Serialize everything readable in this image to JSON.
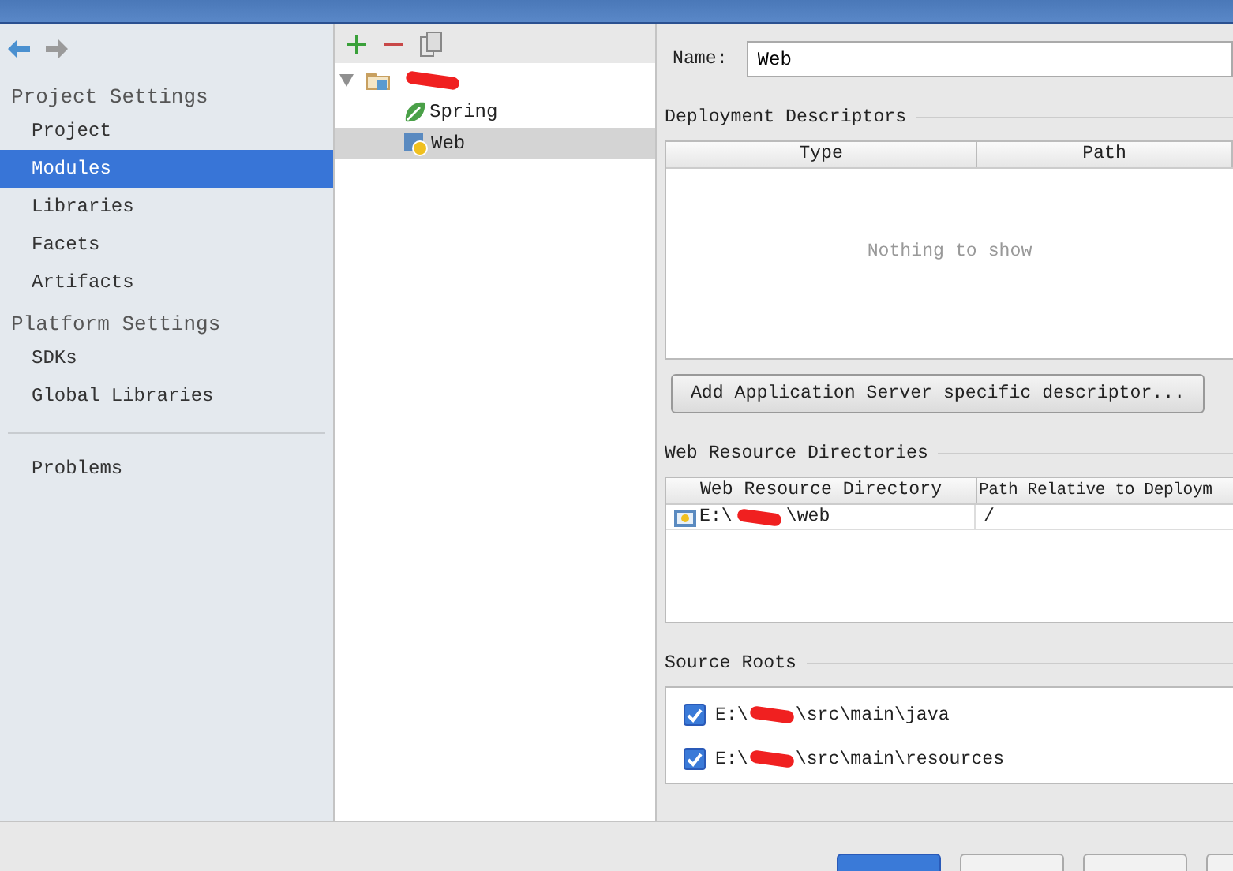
{
  "sidebar": {
    "sections": [
      {
        "title": "Project Settings",
        "items": [
          {
            "label": "Project",
            "selected": false
          },
          {
            "label": "Modules",
            "selected": true
          },
          {
            "label": "Libraries",
            "selected": false
          },
          {
            "label": "Facets",
            "selected": false
          },
          {
            "label": "Artifacts",
            "selected": false
          }
        ]
      },
      {
        "title": "Platform Settings",
        "items": [
          {
            "label": "SDKs",
            "selected": false
          },
          {
            "label": "Global Libraries",
            "selected": false
          }
        ]
      }
    ],
    "bottom_items": [
      {
        "label": "Problems",
        "selected": false
      }
    ]
  },
  "tree": {
    "root": {
      "expanded": true,
      "children": [
        {
          "label": "Spring",
          "kind": "spring",
          "selected": false
        },
        {
          "label": "Web",
          "kind": "web",
          "selected": true
        }
      ]
    }
  },
  "detail": {
    "name_label": "Name:",
    "name_value": "Web",
    "deployment": {
      "title": "Deployment Descriptors",
      "columns": [
        "Type",
        "Path"
      ],
      "empty_text": "Nothing to show",
      "button": "Add Application Server specific descriptor..."
    },
    "web_resources": {
      "title": "Web Resource Directories",
      "columns": [
        "Web Resource Directory",
        "Path Relative to Deploym"
      ],
      "rows": [
        {
          "prefix": "E:\\",
          "suffix": "\\web",
          "relative": "/"
        }
      ]
    },
    "source_roots": {
      "title": "Source Roots",
      "items": [
        {
          "prefix": "E:\\",
          "suffix": "\\src\\main\\java",
          "checked": true
        },
        {
          "prefix": "E:\\",
          "suffix": "\\src\\main\\resources",
          "checked": true
        }
      ]
    }
  }
}
